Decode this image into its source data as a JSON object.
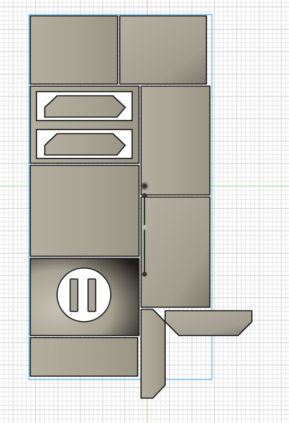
{
  "viewport": {
    "kind": "cad-sketch-canvas",
    "background_color": "#ffffff",
    "grid_minor_color": "#e6e6e6",
    "grid_major_color": "#cfcfcf",
    "x_axis_color": "#9ad59a",
    "y_axis_color": "#f2a3a3",
    "selection_outline_color": "#4fb3ee",
    "panel_fill_color": "#aaa596",
    "panel_edge_color": "#111111",
    "constraint_point_color": "#333333",
    "constraint_point_inactive_color": "#bbbbbb",
    "coin_slot_icon": "coin-slot-icon"
  }
}
